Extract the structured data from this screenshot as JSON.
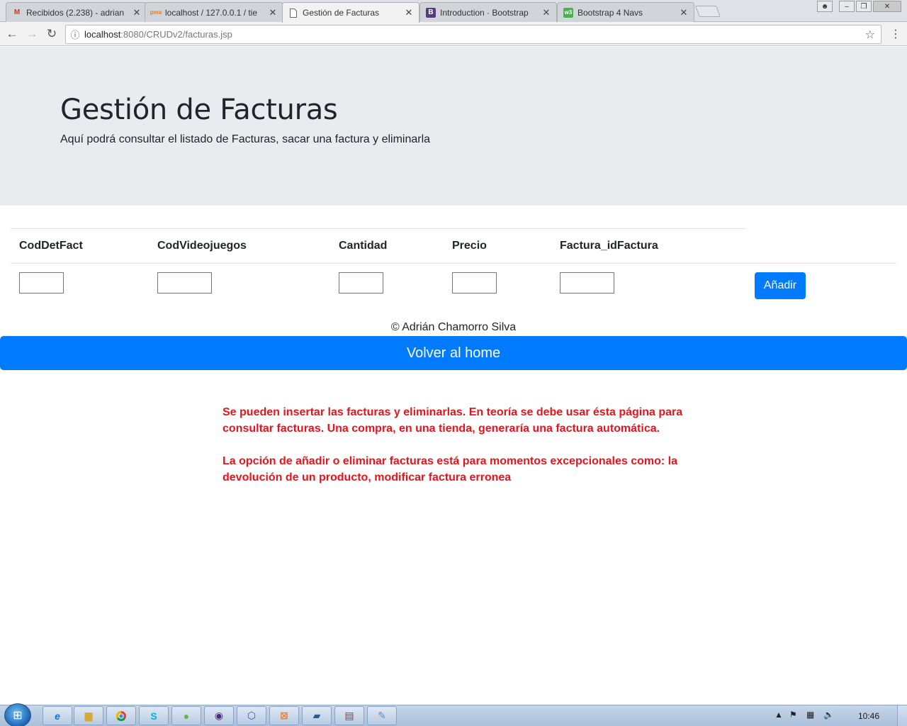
{
  "browser": {
    "tabs": [
      {
        "title": "Recibidos (2.238) - adrian",
        "icon": "gmail-icon"
      },
      {
        "title": "localhost / 127.0.0.1 / tie",
        "icon": "phpmyadmin-icon"
      },
      {
        "title": "Gestión de Facturas",
        "icon": "page-icon",
        "active": true
      },
      {
        "title": "Introduction · Bootstrap",
        "icon": "bootstrap-icon"
      },
      {
        "title": "Bootstrap 4 Navs",
        "icon": "w3schools-icon"
      }
    ],
    "url_host": "localhost",
    "url_rest": ":8080/CRUDv2/facturas.jsp"
  },
  "jumbotron": {
    "title": "Gestión de Facturas",
    "subtitle": "Aquí podrá consultar el listado de Facturas, sacar una factura y eliminarla"
  },
  "table": {
    "headers": [
      "CodDetFact",
      "CodVideojuegos",
      "Cantidad",
      "Precio",
      "Factura_idFactura"
    ],
    "inputs": [
      "",
      "",
      "",
      "",
      ""
    ],
    "add_label": "Añadir"
  },
  "footer": {
    "copyright": "© Adrián Chamorro Silva",
    "home_button": "Volver al home"
  },
  "notes": [
    "Se pueden insertar las facturas y eliminarlas. En teoría se debe usar ésta página para consultar facturas. Una compra, en una tienda, generaría una factura automática.",
    "La opción de añadir o eliminar facturas está para momentos excepcionales como: la devolución de un producto, modificar factura erronea"
  ],
  "taskbar": {
    "clock": "10:46"
  },
  "colors": {
    "primary": "#007bff",
    "note": "#e8141b",
    "jumbotron": "#e9ecef"
  }
}
